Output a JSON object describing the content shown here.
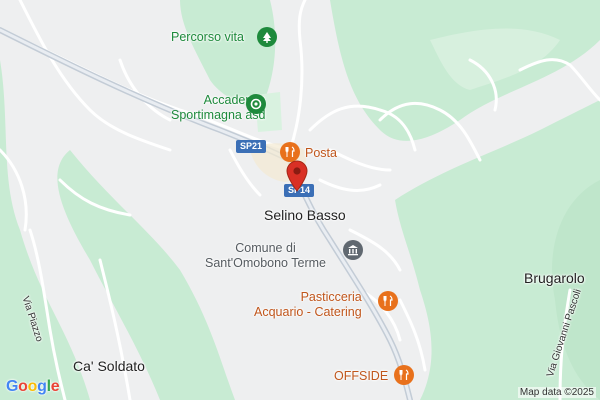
{
  "map": {
    "colors": {
      "land": "#eeeff0",
      "forest": "#c8ebd3",
      "road": "#ffffff",
      "road_edge": "#d6d8db",
      "major_road": "#c3ccd6",
      "poi_green": "#1e8a3c",
      "poi_orange": "#e8711c",
      "poi_gray": "#606870",
      "pin": "#d93025",
      "shield": "#3b6fb6"
    },
    "places": {
      "selino_basso": "Selino Basso",
      "brugarolo": "Brugarolo",
      "ca_soldato": "Ca' Soldato"
    },
    "pois": {
      "percorso_vita": {
        "name": "Percorso vita",
        "icon": "tree-icon"
      },
      "accademia": {
        "line1": "Accademia",
        "line2": "Sportimagna asd",
        "icon": "sports-icon"
      },
      "posta": {
        "name": "Posta",
        "icon": "restaurant-icon"
      },
      "comune": {
        "line1": "Comune di",
        "line2": "Sant'Omobono Terme",
        "icon": "city-hall-icon"
      },
      "pasticceria": {
        "line1": "Pasticceria",
        "line2": "Acquario - Catering",
        "icon": "restaurant-icon"
      },
      "offside": {
        "name": "OFFSIDE",
        "icon": "restaurant-icon"
      }
    },
    "streets": {
      "via_piazzo": "Via Piazzo",
      "via_giovanni_pascoli": "Via Giovanni Pascoli"
    },
    "road_shields": {
      "sp21_left": "SP21",
      "sp21_center": "SP14"
    },
    "marker": {
      "icon": "location-pin-icon"
    },
    "logo": {
      "letters": [
        "G",
        "o",
        "o",
        "g",
        "l",
        "e"
      ],
      "colors": [
        "#4285f4",
        "#ea4335",
        "#fbbc05",
        "#4285f4",
        "#34a853",
        "#ea4335"
      ]
    },
    "attribution": "Map data ©2025"
  }
}
